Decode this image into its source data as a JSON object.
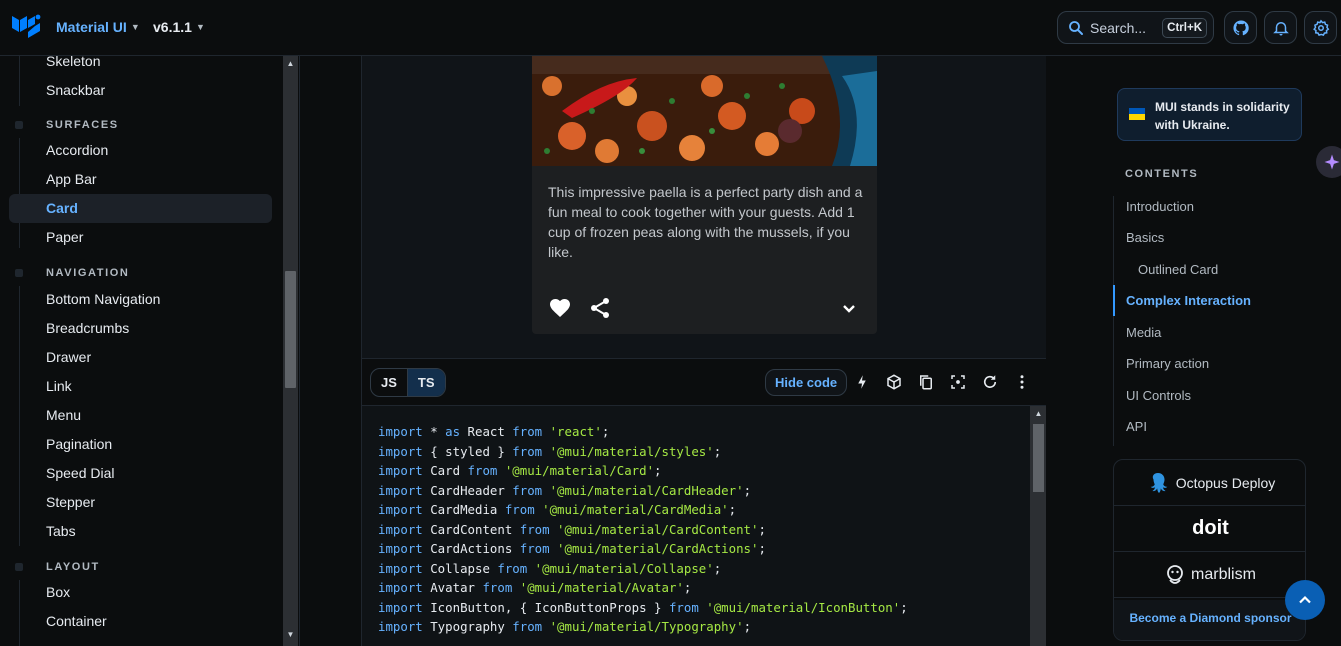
{
  "header": {
    "brand": "Material UI",
    "version": "v6.1.1",
    "search_placeholder": "Search...",
    "search_shortcut": "Ctrl+K",
    "icons": [
      "github-icon",
      "bell-icon",
      "settings-icon"
    ]
  },
  "sidebar": {
    "items_top": [
      "Skeleton",
      "Snackbar"
    ],
    "surfaces_heading": "SURFACES",
    "surfaces": [
      "Accordion",
      "App Bar",
      "Card",
      "Paper"
    ],
    "active_item": "Card",
    "navigation_heading": "NAVIGATION",
    "navigation": [
      "Bottom Navigation",
      "Breadcrumbs",
      "Drawer",
      "Link",
      "Menu",
      "Pagination",
      "Speed Dial",
      "Stepper",
      "Tabs"
    ],
    "layout_heading": "LAYOUT",
    "layout": [
      "Box",
      "Container"
    ]
  },
  "demo": {
    "card_text": "This impressive paella is a perfect party dish and a fun meal to cook together with your guests. Add 1 cup of frozen peas along with the mussels, if you like.",
    "actions": [
      "favorite-icon",
      "share-icon",
      "expand-more-icon"
    ]
  },
  "codebar": {
    "js_label": "JS",
    "ts_label": "TS",
    "selected_language": "TS",
    "hide_code_label": "Hide code",
    "tools": [
      "bolt-icon",
      "cube-icon",
      "copy-icon",
      "fullscreen-icon",
      "refresh-icon",
      "more-icon"
    ]
  },
  "code": {
    "lines": [
      {
        "kw1": "import",
        "mid": " * ",
        "kw2": "as",
        "name": " React ",
        "kw3": "from",
        "str": " 'react'",
        "end": ";"
      },
      {
        "kw1": "import",
        "mid": " { styled } ",
        "kw2": "",
        "name": "",
        "kw3": "from",
        "str": " '@mui/material/styles'",
        "end": ";"
      },
      {
        "kw1": "import",
        "mid": " Card ",
        "kw2": "",
        "name": "",
        "kw3": "from",
        "str": " '@mui/material/Card'",
        "end": ";"
      },
      {
        "kw1": "import",
        "mid": " CardHeader ",
        "kw2": "",
        "name": "",
        "kw3": "from",
        "str": " '@mui/material/CardHeader'",
        "end": ";"
      },
      {
        "kw1": "import",
        "mid": " CardMedia ",
        "kw2": "",
        "name": "",
        "kw3": "from",
        "str": " '@mui/material/CardMedia'",
        "end": ";"
      },
      {
        "kw1": "import",
        "mid": " CardContent ",
        "kw2": "",
        "name": "",
        "kw3": "from",
        "str": " '@mui/material/CardContent'",
        "end": ";"
      },
      {
        "kw1": "import",
        "mid": " CardActions ",
        "kw2": "",
        "name": "",
        "kw3": "from",
        "str": " '@mui/material/CardActions'",
        "end": ";"
      },
      {
        "kw1": "import",
        "mid": " Collapse ",
        "kw2": "",
        "name": "",
        "kw3": "from",
        "str": " '@mui/material/Collapse'",
        "end": ";"
      },
      {
        "kw1": "import",
        "mid": " Avatar ",
        "kw2": "",
        "name": "",
        "kw3": "from",
        "str": " '@mui/material/Avatar'",
        "end": ";"
      },
      {
        "kw1": "import",
        "mid": " IconButton, { IconButtonProps } ",
        "kw2": "",
        "name": "",
        "kw3": "from",
        "str": " '@mui/material/IconButton'",
        "end": ";"
      },
      {
        "kw1": "import",
        "mid": " Typography ",
        "kw2": "",
        "name": "",
        "kw3": "from",
        "str": " '@mui/material/Typography'",
        "end": ";"
      }
    ]
  },
  "toc": {
    "banner": "MUI stands in solidarity with Ukraine.",
    "heading": "CONTENTS",
    "items": [
      "Introduction",
      "Basics",
      "Outlined Card",
      "Complex Interaction",
      "Media",
      "Primary action",
      "UI Controls",
      "API"
    ],
    "active": "Complex Interaction",
    "sponsors": [
      "Octopus Deploy",
      "doit",
      "marblism"
    ],
    "sponsor_cta": "Become a Diamond sponsor"
  },
  "colors": {
    "accent": "#66b2ff",
    "background": "#0b0d0e",
    "string": "#a5e844"
  }
}
